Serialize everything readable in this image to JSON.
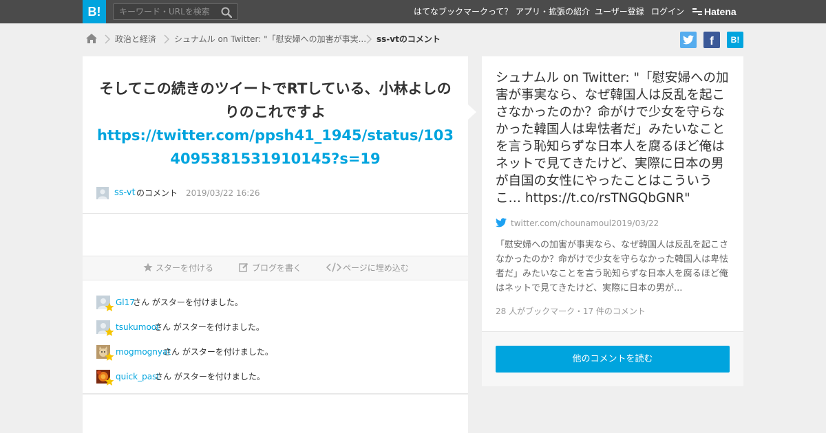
{
  "header": {
    "logo_label": "B!",
    "search_placeholder": "キーワード・URLを検索",
    "nav": [
      {
        "label": "はてなブックマークって？"
      },
      {
        "label": "アプリ・拡張の紹介"
      },
      {
        "label": "ユーザー登録"
      },
      {
        "label": "ログイン"
      }
    ],
    "brand": "Hatena"
  },
  "breadcrumb": [
    {
      "label": "政治と経済"
    },
    {
      "label": "シュナムル on Twitter: \"「慰安婦への加害が事実..."
    },
    {
      "label": "ss-vtのコメント"
    }
  ],
  "share": {
    "twitter_label": "t",
    "facebook_label": "f",
    "hatena_label": "B!"
  },
  "comment": {
    "text": "そしてこの続きのツイートでRTしている、小林よしのりのこれですよ",
    "link": "https://twitter.com/ppsh41_1945/status/1034095381531910145?s=19",
    "user": "ss-vt",
    "user_suffix": "のコメント",
    "date": "2019/03/22 16:26"
  },
  "actions": {
    "star": "スターを付ける",
    "blog": "ブログを書く",
    "embed": "ページに埋め込む"
  },
  "stars": [
    {
      "user": "Gl17",
      "suffix": "さん がスターを付けました。"
    },
    {
      "user": "tsukumoot",
      "suffix": "さん がスターを付けました。"
    },
    {
      "user": "mogmognyat",
      "suffix": "さん がスターを付けました。"
    },
    {
      "user": "quick_past",
      "suffix": "さん がスターを付けました。"
    }
  ],
  "entry": {
    "title": "シュナムル on Twitter: \"「慰安婦への加害が事実なら、なぜ韓国人は反乱を起こさなかったのか？命がけで少女を守らなかった韓国人は卑怯者だ」みたいなことを言う恥知らずな日本人を腐るほど俺はネットで見てきたけど、実際に日本の男が自国の女性にやったことはこういうこ… https://t.co/rsTNGQbGNR\"",
    "source": "twitter.com/chounamoul",
    "date": "2019/03/22",
    "description": "「慰安婦への加害が事実なら、なぜ韓国人は反乱を起こさなかったのか？命がけで少女を守らなかった韓国人は卑怯者だ」みたいなことを言う恥知らずな日本人を腐るほど俺はネットで見てきたけど、実際に日本の男が...",
    "stats": "28 人がブックマーク・17 件のコメント",
    "read_button": "他のコメントを読む"
  },
  "colors": {
    "accent": "#00a4de",
    "topbar": "#4b4b4b",
    "background": "#efefef",
    "twitter": "#55acee",
    "facebook": "#3b5998",
    "star": "#f5c400"
  }
}
